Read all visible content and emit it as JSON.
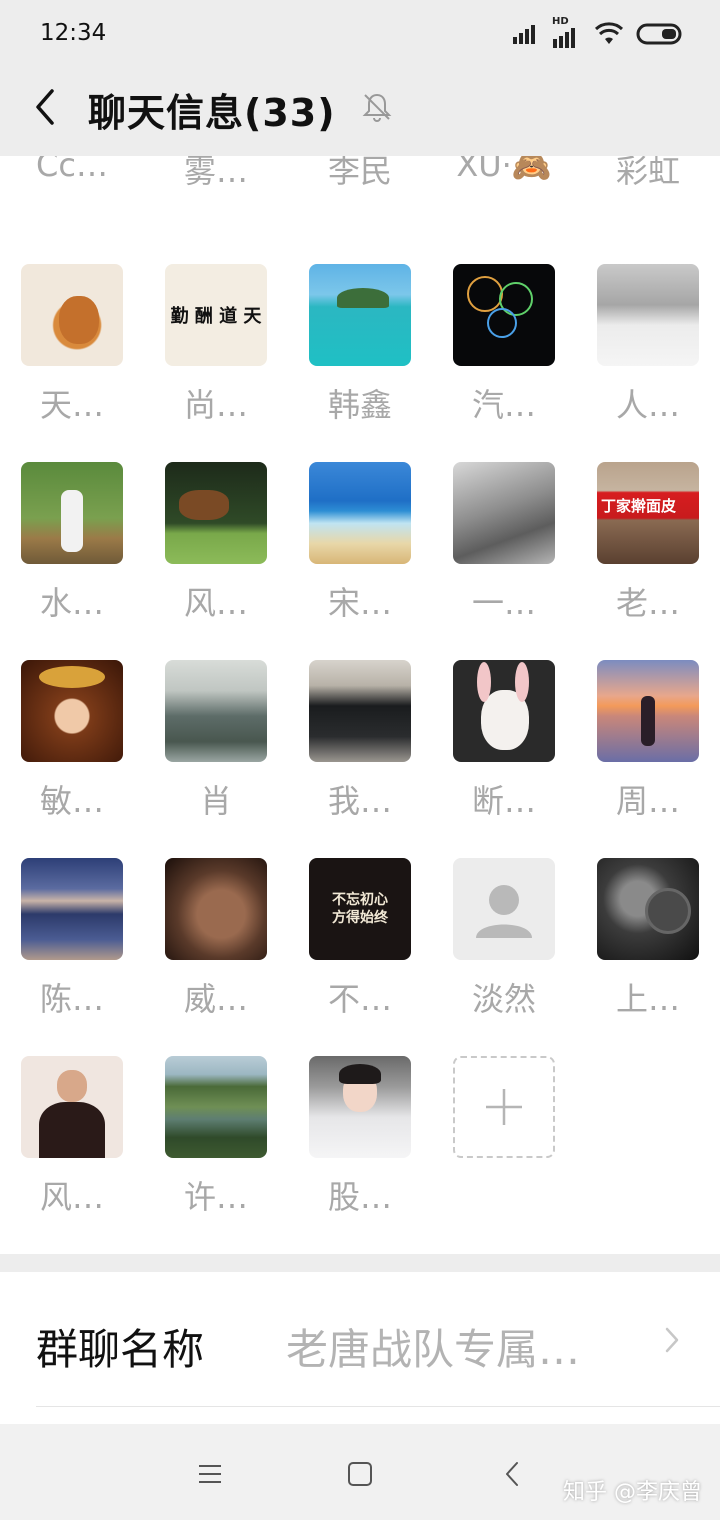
{
  "status_bar": {
    "time": "12:34",
    "network_label": "HD"
  },
  "header": {
    "title": "聊天信息(33)",
    "back_icon": "chevron-left-icon",
    "mute_icon": "bell-off-icon"
  },
  "members": {
    "partial_row": [
      "Cc…",
      "雾…",
      "李民",
      "XU·🙈",
      "彩虹"
    ],
    "rows": [
      [
        "天…",
        "尚…",
        "韩鑫",
        "汽…",
        "人…"
      ],
      [
        "水…",
        "风…",
        "宋…",
        "一…",
        "老…"
      ],
      [
        "敏…",
        "肖",
        "我…",
        "断…",
        "周…"
      ],
      [
        "陈…",
        "威…",
        "不…",
        "淡然",
        "上…"
      ],
      [
        "风…",
        "许…",
        "股…"
      ]
    ],
    "add_icon": "plus-icon",
    "avatar_texts": {
      "calligraphy": "勤 酬 道 天",
      "poster": "不忘初心\n方得始终",
      "shop_sign": "丁家擀面皮"
    }
  },
  "settings": {
    "group_name_label": "群聊名称",
    "group_name_value": "老唐战队专属…"
  },
  "nav_bar": {
    "menu_icon": "menu-icon",
    "home_icon": "square-home-icon",
    "back_icon": "back-triangle-icon",
    "watermark": "知乎 @李庆曾"
  },
  "colors": {
    "header_bg": "#ededed",
    "name_gray": "#a8a8a8",
    "value_gray": "#b3b3b3"
  }
}
